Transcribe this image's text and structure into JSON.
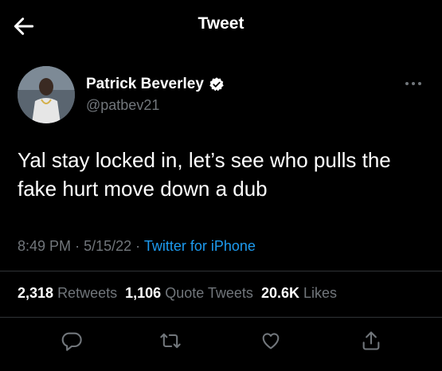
{
  "header": {
    "title": "Tweet",
    "back_icon": "back-arrow-icon"
  },
  "author": {
    "name": "Patrick Beverley",
    "handle": "@patbev21",
    "verified_icon": "verified-badge-icon",
    "more_icon": "more-options-icon"
  },
  "tweet": {
    "text": "Yal stay locked in, let’s see who pulls the fake hurt move down a dub",
    "time": "8:49 PM",
    "date": "5/15/22",
    "source": "Twitter for iPhone"
  },
  "stats": {
    "retweets_count": "2,318",
    "retweets_label": "Retweets",
    "quotes_count": "1,106",
    "quotes_label": "Quote Tweets",
    "likes_count": "20.6K",
    "likes_label": "Likes"
  },
  "actions": {
    "reply_icon": "reply-icon",
    "retweet_icon": "retweet-icon",
    "like_icon": "like-icon",
    "share_icon": "share-icon"
  },
  "colors": {
    "background": "#000000",
    "text": "#ffffff",
    "muted": "#71767b",
    "link": "#1d9bf0",
    "divider": "#2f3336"
  }
}
